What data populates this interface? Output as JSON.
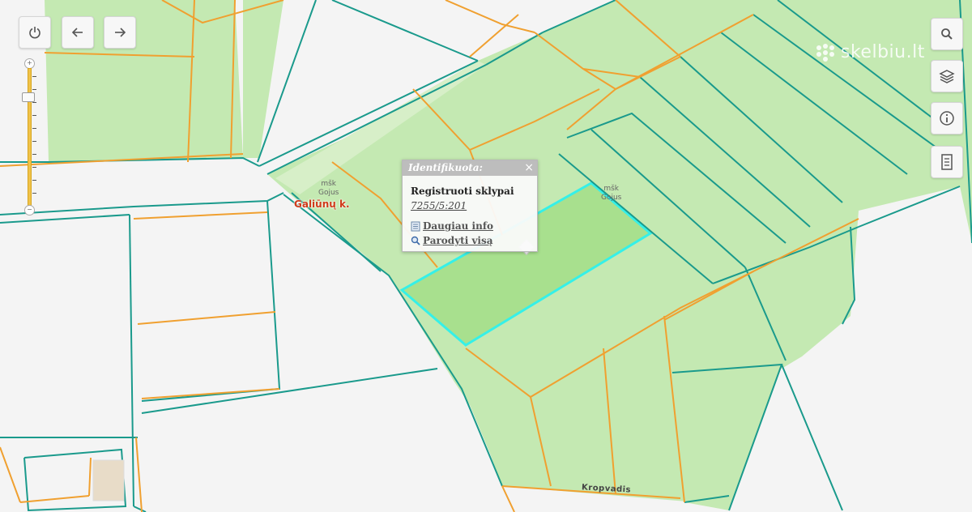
{
  "map": {
    "labels": {
      "village": "Galiūnų k.",
      "forest_1_line1": "mšk",
      "forest_1_line2": "Gojus",
      "forest_2_line1": "mšk",
      "forest_2_line2": "Gojus",
      "road": "Kropvadis"
    },
    "colors": {
      "parcel_fill": "#c4e9b2",
      "parcel_fill_highlight": "#a8e08e",
      "boundary_teal": "#1a9a8c",
      "boundary_orange": "#f0a030",
      "selection": "#35f0e8",
      "village_label": "#d03a1a",
      "background": "#f4f4f4"
    }
  },
  "controls": {
    "left": [
      {
        "name": "power-icon"
      },
      {
        "name": "back-arrow-icon"
      },
      {
        "name": "forward-arrow-icon"
      }
    ],
    "right": [
      {
        "name": "search-icon"
      },
      {
        "name": "layers-icon"
      },
      {
        "name": "info-icon"
      },
      {
        "name": "legend-document-icon"
      }
    ]
  },
  "popup": {
    "title": "Identifikuota:",
    "close": "×",
    "layer": "Registruoti sklypai",
    "parcel_id": "7255/5:201",
    "more_info": "Daugiau info",
    "show_all": "Parodyti visą"
  },
  "watermark": {
    "text": "skelbiu.lt"
  }
}
